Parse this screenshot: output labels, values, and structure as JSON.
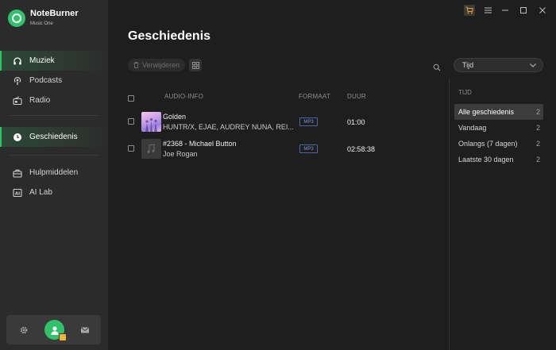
{
  "app": {
    "name": "NoteBurner",
    "subtitle": "Music One"
  },
  "window_controls": [
    "cart-icon",
    "menu-icon",
    "minimize-icon",
    "maximize-icon",
    "close-icon"
  ],
  "sidebar": {
    "items": [
      {
        "label": "Muziek",
        "icon": "headphones-icon",
        "active": true
      },
      {
        "label": "Podcasts",
        "icon": "podcast-icon",
        "active": false
      },
      {
        "label": "Radio",
        "icon": "radio-icon",
        "active": false
      },
      {
        "label": "Geschiedenis",
        "icon": "clock-icon",
        "active": true
      },
      {
        "label": "Hulpmiddelen",
        "icon": "toolbox-icon",
        "active": false
      },
      {
        "label": "AI Lab",
        "icon": "ai-icon",
        "active": false
      }
    ],
    "bottom": [
      "settings-icon",
      "avatar",
      "mail-icon"
    ]
  },
  "main": {
    "title": "Geschiedenis",
    "delete_label": "Verwijderen",
    "sort_select": "Tijd"
  },
  "table": {
    "headers": {
      "info": "AUDIO-INFO",
      "format": "FORMAAT",
      "duration": "DUUR"
    },
    "rows": [
      {
        "title": "Golden",
        "artist": "HUNTR/X, EJAE, AUDREY NUNA, REI...",
        "format": "MP3",
        "duration": "01:00"
      },
      {
        "title": "#2368 - Michael Button",
        "artist": "Joe Rogan",
        "format": "MP3",
        "duration": "02:58:38"
      }
    ]
  },
  "history_panel": {
    "heading": "TIJD",
    "items": [
      {
        "label": "Alle geschiedenis",
        "count": "2",
        "active": true
      },
      {
        "label": "Vandaag",
        "count": "2",
        "active": false
      },
      {
        "label": "Onlangs (7 dagen)",
        "count": "2",
        "active": false
      },
      {
        "label": "Laatste 30 dagen",
        "count": "2",
        "active": false
      }
    ]
  },
  "colors": {
    "accent": "#2fc26a",
    "sidebar": "#2b2b2b",
    "background": "#1e1e1e",
    "format_badge": "#4b66a8"
  }
}
